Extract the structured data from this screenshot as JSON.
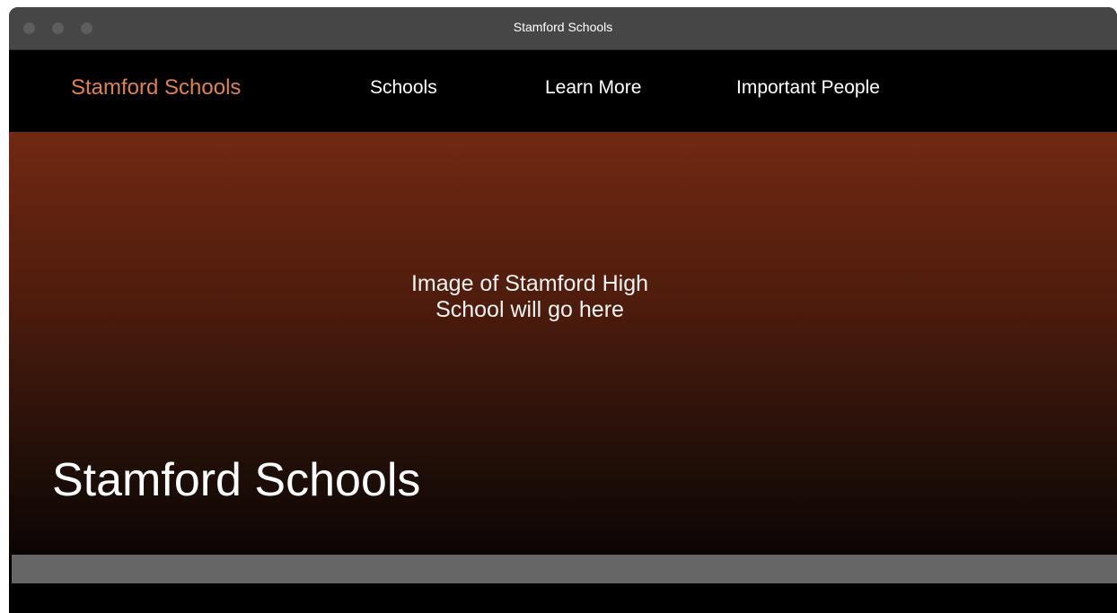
{
  "window": {
    "title": "Stamford Schools"
  },
  "nav": {
    "brand": "Stamford Schools",
    "items": [
      {
        "label": "Schools"
      },
      {
        "label": "Learn More"
      },
      {
        "label": "Important People"
      }
    ]
  },
  "hero": {
    "placeholder_line1": "Image of Stamford High",
    "placeholder_line2": "School will go here",
    "title": "Stamford Schools"
  },
  "colors": {
    "brand_accent": "#e0814f",
    "hero_top": "#722912",
    "hero_bottom": "#0b0503",
    "band": "#666666"
  }
}
